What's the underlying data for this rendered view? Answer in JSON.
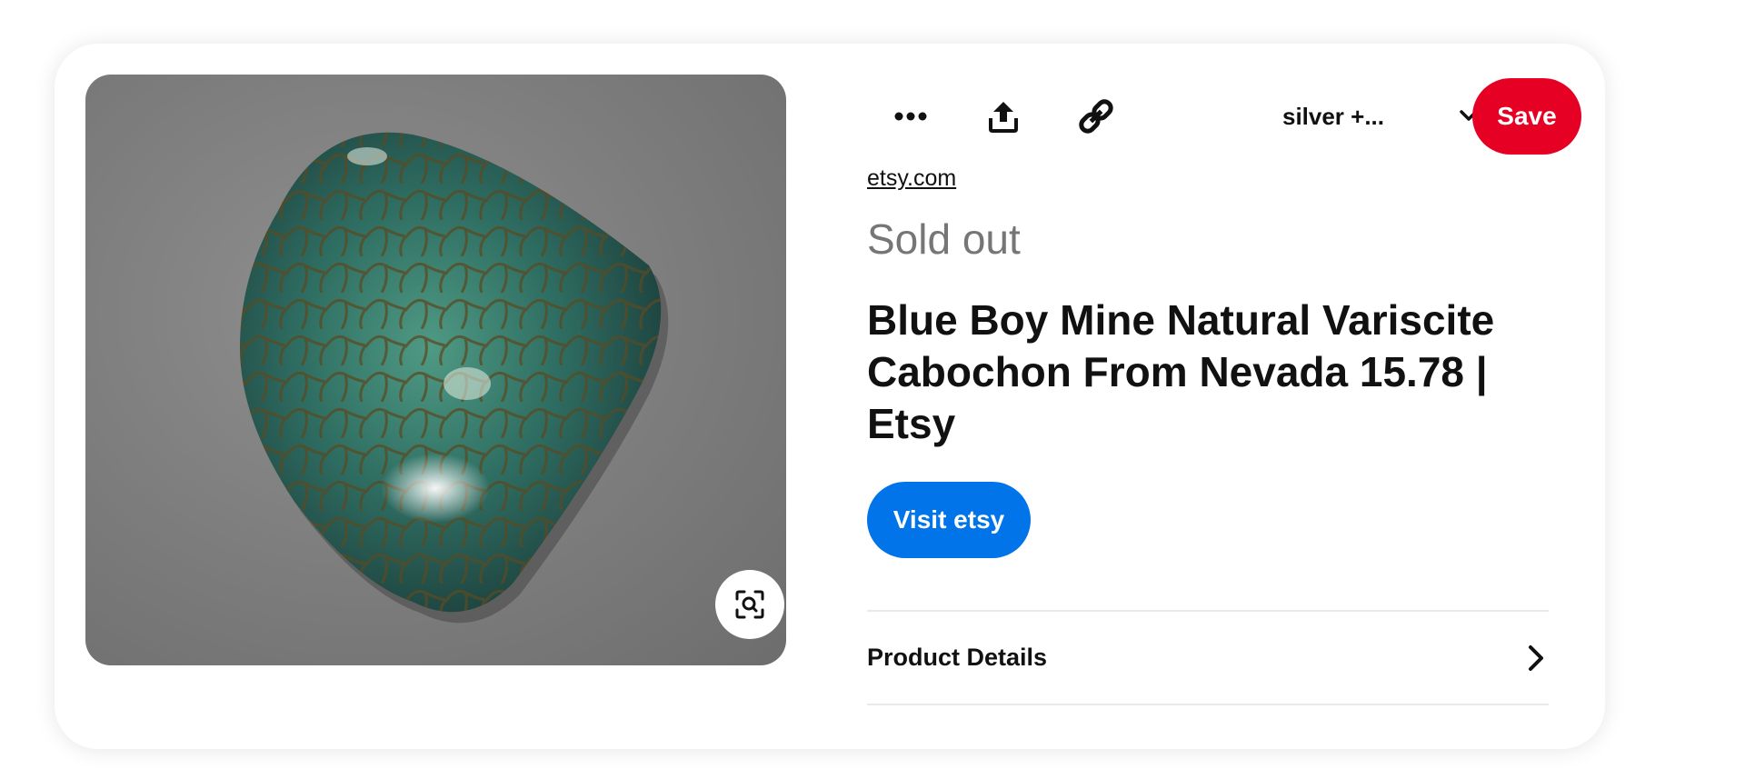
{
  "pin": {
    "image_alt": "Blue Boy Mine Natural Variscite cabochon",
    "toolbar": {
      "more_icon": "more-dots-icon",
      "share_icon": "share-upload-icon",
      "link_icon": "chain-link-icon",
      "board_name": "silver +...",
      "board_chevron_icon": "chevron-down-icon",
      "save_label": "Save"
    },
    "source": "etsy.com",
    "availability": "Sold out",
    "title": "Blue Boy Mine Natural Variscite Cabochon From Nevada 15.78 | Etsy",
    "visit_label": "Visit etsy",
    "product_details_label": "Product Details",
    "product_details_icon": "chevron-right-icon",
    "visual_search_icon": "visual-search-lens-icon"
  },
  "colors": {
    "save": "#e60023",
    "visit": "#0074e8",
    "availability_text": "#767676"
  }
}
